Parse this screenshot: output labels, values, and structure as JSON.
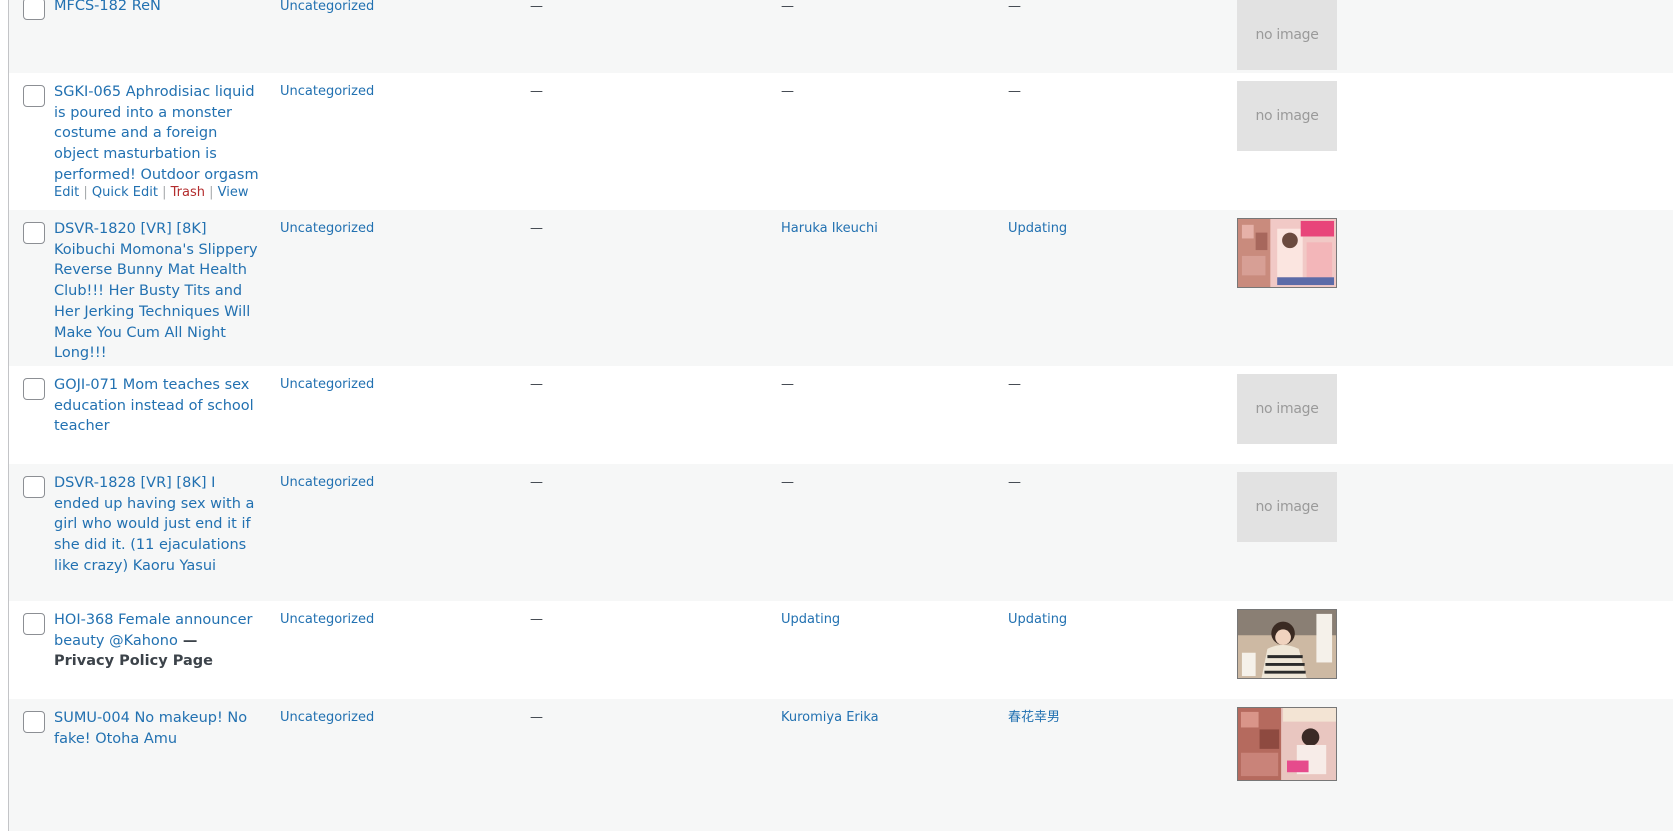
{
  "dash": "—",
  "no_image_label": "no image",
  "row_actions": {
    "edit": "Edit",
    "quick_edit": "Quick Edit",
    "trash": "Trash",
    "view": "View",
    "sep": "|"
  },
  "rows": [
    {
      "title": "MFCS-182 ReN",
      "category": "Uncategorized",
      "col3": "—",
      "col4": "—",
      "col5": "—",
      "thumbnail": "no image"
    },
    {
      "title": "SGKI-065 Aphrodisiac liquid is poured into a monster costume and a foreign object masturbation is performed! Outdoor orgasm",
      "category": "Uncategorized",
      "col3": "—",
      "col4": "—",
      "col5": "—",
      "thumbnail": "no image"
    },
    {
      "title": "DSVR-1820 [VR] [8K] Koibuchi Momona's Slippery Reverse Bunny Mat Health Club!!! Her Busty Tits and Her Jerking Techniques Will Make You Cum All Night Long!!!",
      "category": "Uncategorized",
      "col3": "—",
      "col4": "Haruka Ikeuchi",
      "col5": "Updating",
      "thumbnail": "cover"
    },
    {
      "title": "GOJI-071 Mom teaches sex education instead of school teacher",
      "category": "Uncategorized",
      "col3": "—",
      "col4": "—",
      "col5": "—",
      "thumbnail": "no image"
    },
    {
      "title": "DSVR-1828 [VR] [8K] I ended up having sex with a girl who would just end it if she did it. (11 ejaculations like crazy) Kaoru Yasui",
      "category": "Uncategorized",
      "col3": "—",
      "col4": "—",
      "col5": "—",
      "thumbnail": "no image"
    },
    {
      "title": "HOI-368 Female announcer beauty @Kahono",
      "post_state_sep": " — ",
      "post_state": "Privacy Policy Page",
      "category": "Uncategorized",
      "col3": "—",
      "col4": "Updating",
      "col5": "Updating",
      "thumbnail": "cover"
    },
    {
      "title": "SUMU-004 No makeup! No fake! Otoha Amu",
      "category": "Uncategorized",
      "col3": "—",
      "col4": "Kuromiya Erika",
      "col5": "春花幸男",
      "thumbnail": "cover"
    }
  ]
}
